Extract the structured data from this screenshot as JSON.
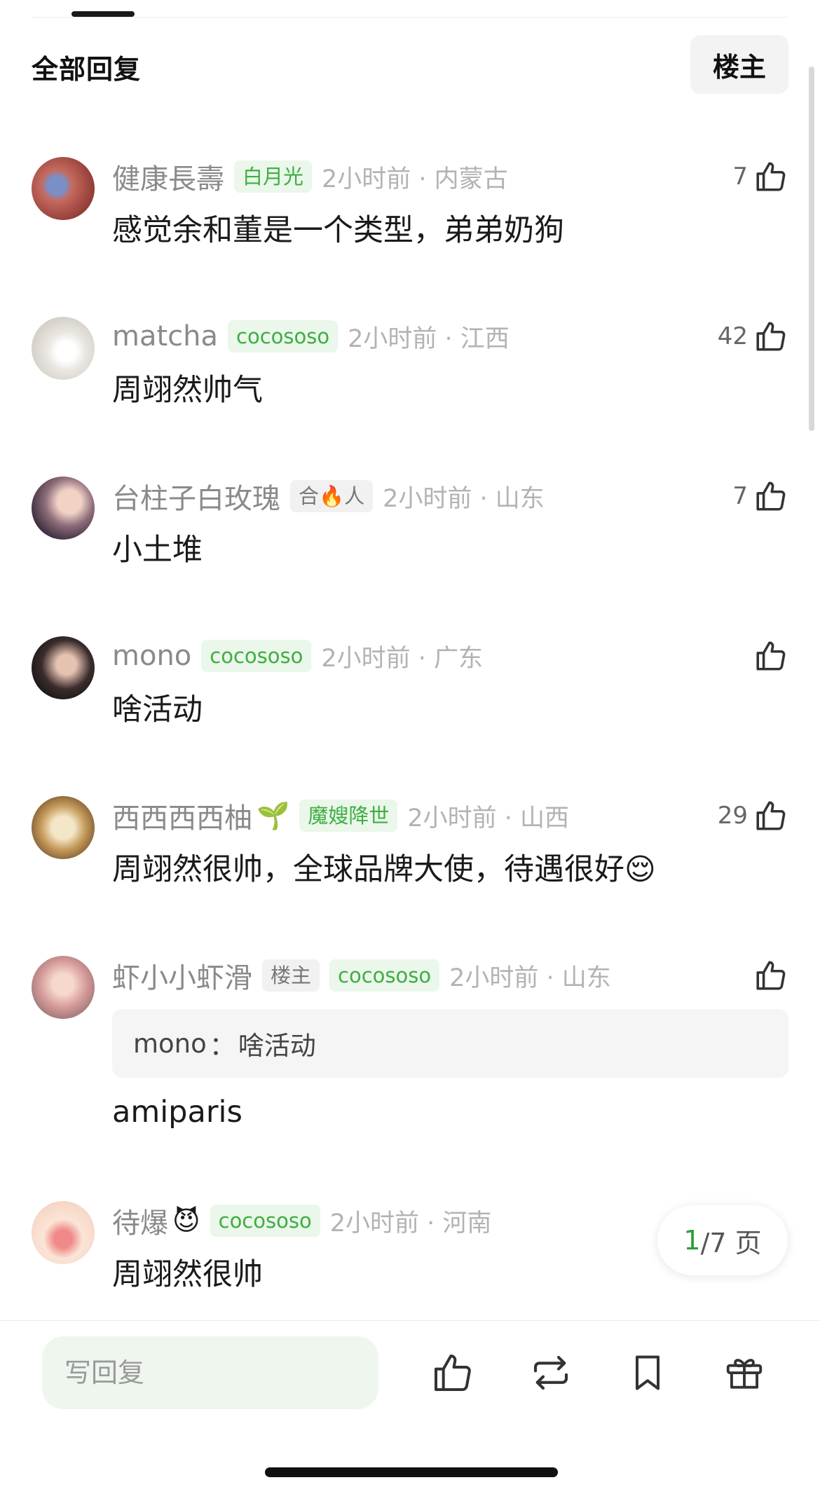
{
  "header": {
    "title": "全部回复",
    "op_filter_label": "楼主"
  },
  "comments": [
    {
      "username": "健康長壽",
      "tags": [
        "白月光"
      ],
      "time": "2小时前 · 内蒙古",
      "text": "感觉余和董是一个类型，弟弟奶狗",
      "likes": "7"
    },
    {
      "username": "matcha",
      "tags": [
        "cocososo"
      ],
      "time": "2小时前 · 江西",
      "text": "周翊然帅气",
      "likes": "42"
    },
    {
      "username": "台柱子白玫瑰",
      "tags": [
        "合🔥人"
      ],
      "time": "2小时前 · 山东",
      "text": "小土堆",
      "likes": "7"
    },
    {
      "username": "mono",
      "tags": [
        "cocososo"
      ],
      "time": "2小时前 · 广东",
      "text": "啥活动",
      "likes": ""
    },
    {
      "username": "西西西西柚",
      "username_emoji": "🌱",
      "tags": [
        "魔嫂降世"
      ],
      "time": "2小时前 · 山西",
      "text": "周翊然很帅，全球品牌大使，待遇很好😌",
      "likes": "29"
    },
    {
      "username": "虾小小虾滑",
      "tags": [
        "楼主",
        "cocososo"
      ],
      "time": "2小时前 · 山东",
      "quote": {
        "user": "mono",
        "separator": "：",
        "text": "啥活动"
      },
      "text": "amiparis",
      "likes": ""
    },
    {
      "username": "待爆",
      "username_emoji": "😈",
      "tags": [
        "cocososo"
      ],
      "time": "2小时前 · 河南",
      "text": "周翊然很帅",
      "likes": ""
    }
  ],
  "pagination": {
    "current": "1",
    "rest": "/7 页"
  },
  "bottom_bar": {
    "reply_placeholder": "写回复"
  },
  "colors": {
    "accent_green": "#3fae43",
    "tag_green_bg": "#eaf7ea",
    "meta_gray": "#8a8a8a",
    "text_dark": "#1a1a1a"
  },
  "icons": [
    "thumbs-up-icon",
    "repost-icon",
    "bookmark-icon",
    "gift-icon"
  ]
}
